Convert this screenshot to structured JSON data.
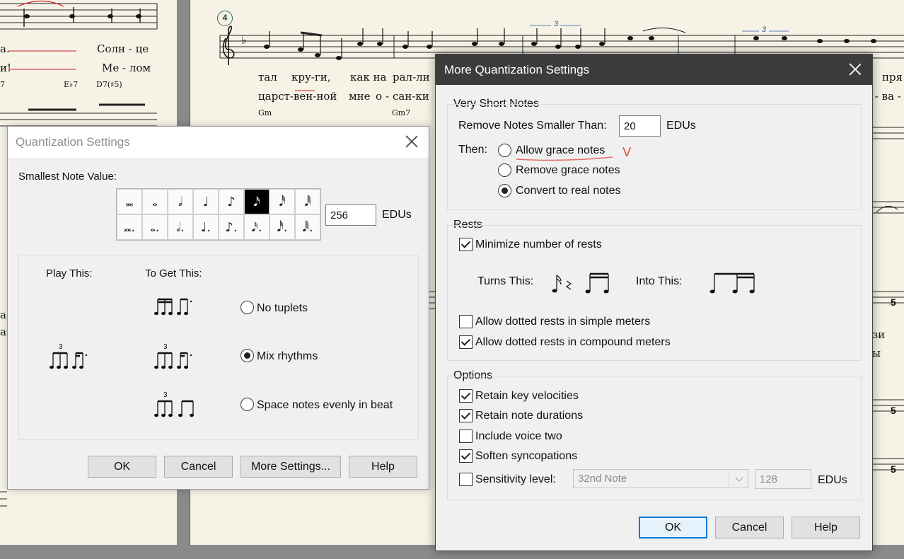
{
  "score": {
    "rehearsal_mark": "4",
    "left_lyrics_1": [
      "а.",
      "Солн - це"
    ],
    "left_lyrics_2": [
      "и!",
      "Ме - лом"
    ],
    "left_chords": [
      "7",
      "E♭7",
      "D7(♯5)"
    ],
    "left_fragments": [
      "а",
      "ах"
    ],
    "right_lyrics_1": [
      "тал",
      "кру-ги,",
      "как на",
      "рал-ли"
    ],
    "right_lyrics_2": [
      "царст-вен-ной",
      "мне",
      "о",
      "-",
      "сан-ки"
    ],
    "right_chords": [
      "Gm",
      "Gm7"
    ],
    "right_fragments": [
      "пря",
      "о - ва -",
      "зи",
      "ы"
    ],
    "triplet": "3"
  },
  "quantization_dialog": {
    "title": "Quantization Settings",
    "smallest_note_label": "Smallest Note Value:",
    "note_values_row1": [
      "𝅜",
      "𝅝",
      "𝅗𝅥",
      "♩",
      "♪",
      "𝅘𝅥𝅯",
      "𝅘𝅥𝅰",
      "𝅘𝅥𝅱"
    ],
    "note_values_row2": [
      "𝅜.",
      "𝅝.",
      "𝅗𝅥.",
      "♩.",
      "♪.",
      "𝅘𝅥𝅯.",
      "𝅘𝅥𝅰.",
      "𝅘𝅥𝅱."
    ],
    "selected_note_index": 5,
    "edus_value": "256",
    "edus_unit": "EDUs",
    "play_this_label": "Play This:",
    "to_get_this_label": "To Get This:",
    "options": [
      {
        "label": "No tuplets",
        "checked": false
      },
      {
        "label": "Mix rhythms",
        "checked": true
      },
      {
        "label": "Space notes evenly in beat",
        "checked": false
      }
    ],
    "tuplet_number": "3",
    "buttons": {
      "ok": "OK",
      "cancel": "Cancel",
      "more": "More Settings...",
      "help": "Help"
    }
  },
  "more_dialog": {
    "title": "More Quantization Settings",
    "very_short_notes": {
      "header": "Very Short Notes",
      "remove_label": "Remove Notes Smaller Than:",
      "remove_value": "20",
      "unit": "EDUs",
      "then_label": "Then:",
      "options": [
        {
          "label": "Allow grace notes",
          "checked": false
        },
        {
          "label": "Remove grace notes",
          "checked": false
        },
        {
          "label": "Convert to real notes",
          "checked": true
        }
      ],
      "annotation_mark": "V"
    },
    "rests": {
      "header": "Rests",
      "minimize_label": "Minimize number of rests",
      "minimize_checked": true,
      "turns_this": "Turns This:",
      "into_this": "Into This:",
      "dotted_simple_label": "Allow dotted rests in simple meters",
      "dotted_simple_checked": false,
      "dotted_compound_label": "Allow dotted rests in compound meters",
      "dotted_compound_checked": true
    },
    "options": {
      "header": "Options",
      "items": [
        {
          "label": "Retain key velocities",
          "checked": true
        },
        {
          "label": "Retain note durations",
          "checked": true
        },
        {
          "label": "Include voice two",
          "checked": false
        },
        {
          "label": "Soften syncopations",
          "checked": true
        }
      ],
      "sensitivity_label": "Sensitivity level:",
      "sensitivity_checked": false,
      "sensitivity_select": "32nd Note",
      "sensitivity_value": "128",
      "sensitivity_unit": "EDUs"
    },
    "buttons": {
      "ok": "OK",
      "cancel": "Cancel",
      "help": "Help"
    }
  },
  "colors": {
    "accent": "#0078d7",
    "dark_title": "#3c3c3c",
    "annotation": "#e0524a",
    "score_paper": "#f6f3e6",
    "rehearsal": "#2e6b5e"
  }
}
